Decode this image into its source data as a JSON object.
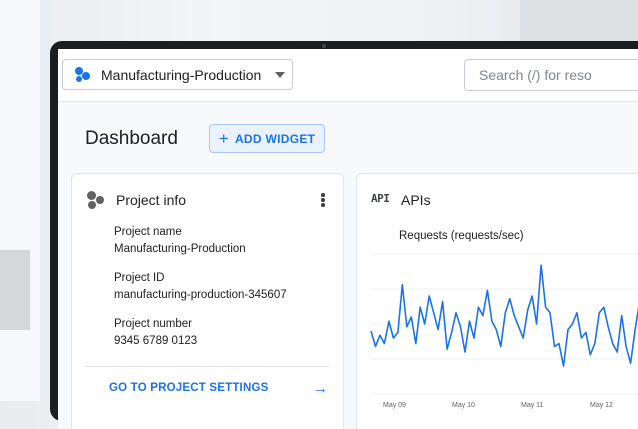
{
  "topbar": {
    "project_name": "Manufacturing-Production",
    "search_placeholder": "Search (/) for reso"
  },
  "dashboard": {
    "title": "Dashboard",
    "add_widget_label": "ADD WIDGET"
  },
  "project_card": {
    "title": "Project info",
    "fields": [
      {
        "label": "Project name",
        "value": "Manufacturing-Production"
      },
      {
        "label": "Project ID",
        "value": "manufacturing-production-345607"
      },
      {
        "label": "Project number",
        "value": "9345 6789 0123"
      }
    ],
    "settings_link": "GO TO PROJECT SETTINGS"
  },
  "apis_card": {
    "icon_text": "API",
    "title": "APIs"
  },
  "colors": {
    "accent": "#1a73e8",
    "chart_line": "#1a73e8"
  },
  "chart_data": {
    "type": "line",
    "title": "Requests (requests/sec)",
    "x_tick_labels": [
      "May 09",
      "May 10",
      "May 11",
      "May 12"
    ],
    "series": [
      {
        "values": [
          0.45,
          0.34,
          0.42,
          0.36,
          0.52,
          0.4,
          0.44,
          0.78,
          0.48,
          0.55,
          0.36,
          0.62,
          0.5,
          0.7,
          0.58,
          0.46,
          0.66,
          0.32,
          0.44,
          0.58,
          0.48,
          0.3,
          0.52,
          0.4,
          0.62,
          0.56,
          0.74,
          0.52,
          0.46,
          0.34,
          0.58,
          0.68,
          0.56,
          0.48,
          0.4,
          0.6,
          0.7,
          0.5,
          0.92,
          0.62,
          0.58,
          0.34,
          0.36,
          0.2,
          0.46,
          0.5,
          0.58,
          0.4,
          0.44,
          0.28,
          0.36,
          0.58,
          0.62,
          0.48,
          0.36,
          0.3,
          0.56,
          0.34,
          0.22,
          0.46,
          0.66,
          0.6,
          0.7,
          0.76
        ]
      }
    ],
    "ylim": [
      0,
      1
    ],
    "grid": true
  }
}
